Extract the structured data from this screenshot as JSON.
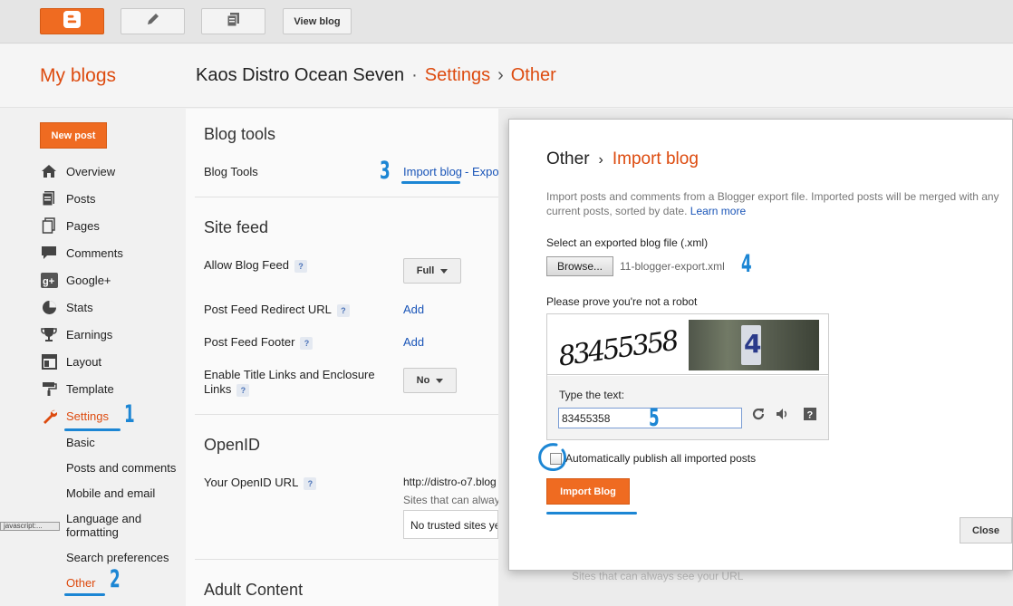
{
  "topbar": {
    "view_blog": "View blog"
  },
  "header": {
    "my_blogs": "My blogs",
    "blog_name": "Kaos Distro Ocean Seven",
    "dot": "·",
    "settings": "Settings",
    "arrow": "›",
    "other": "Other"
  },
  "sidebar": {
    "new_post": "New post",
    "items": [
      {
        "label": "Overview",
        "icon": "home-icon"
      },
      {
        "label": "Posts",
        "icon": "posts-icon"
      },
      {
        "label": "Pages",
        "icon": "pages-icon"
      },
      {
        "label": "Comments",
        "icon": "comments-icon"
      },
      {
        "label": "Google+",
        "icon": "google-plus-icon"
      },
      {
        "label": "Stats",
        "icon": "stats-icon"
      },
      {
        "label": "Earnings",
        "icon": "trophy-icon"
      },
      {
        "label": "Layout",
        "icon": "layout-icon"
      },
      {
        "label": "Template",
        "icon": "paint-roller-icon"
      },
      {
        "label": "Settings",
        "icon": "wrench-icon"
      }
    ],
    "sub_items": [
      {
        "label": "Basic"
      },
      {
        "label": "Posts and comments"
      },
      {
        "label": "Mobile and email"
      },
      {
        "label": "Language and formatting"
      },
      {
        "label": "Search preferences"
      },
      {
        "label": "Other"
      }
    ],
    "js_tag": "javascript:..."
  },
  "main": {
    "blog_tools": {
      "title": "Blog tools",
      "label": "Blog Tools",
      "import_link": "Import blog",
      "dash": "-",
      "export_link": "Expo"
    },
    "site_feed": {
      "title": "Site feed",
      "allow_feed": {
        "label": "Allow Blog Feed",
        "value": "Full"
      },
      "redirect": {
        "label": "Post Feed Redirect URL",
        "link": "Add"
      },
      "footer": {
        "label": "Post Feed Footer",
        "link": "Add"
      },
      "title_links": {
        "label": "Enable Title Links and Enclosure Links",
        "value": "No"
      }
    },
    "openid": {
      "title": "OpenID",
      "label": "Your OpenID URL",
      "url": "http://distro-o7.blog",
      "trusted_note": "Sites that can alway",
      "trusted_box": "No trusted sites ye"
    },
    "adult": {
      "title": "Adult Content"
    },
    "help_mark": "?",
    "behind_text": "Sites that can always see your URL"
  },
  "dialog": {
    "crumb_other": "Other",
    "crumb_sep": "›",
    "crumb_import": "Import blog",
    "desc": "Import posts and comments from a Blogger export file. Imported posts will be merged with any current posts, sorted by date.",
    "learn_more": "Learn more",
    "select_label": "Select an exported blog file (.xml)",
    "browse": "Browse...",
    "filename": "11-blogger-export.xml",
    "robot_label": "Please prove you're not a robot",
    "captcha_text": "83455358",
    "captcha_photo_digit": "4",
    "type_label": "Type the text:",
    "captcha_value": "83455358",
    "auto_publish": "Automatically publish all imported posts",
    "import_btn": "Import Blog",
    "close_btn": "Close"
  },
  "annotations": {
    "n1": "1",
    "n2": "2",
    "n3": "3",
    "n4": "4",
    "n5": "5"
  },
  "colors": {
    "accent": "#dd4b0f",
    "button": "#ef6b21",
    "link": "#1a55b8",
    "annotation": "#1c86d4"
  }
}
